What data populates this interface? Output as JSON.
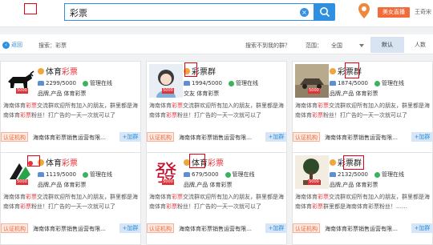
{
  "header": {
    "search_value": "彩票",
    "live_label": "美女直播",
    "user_label": "王奇宋"
  },
  "filters": {
    "back_label": "返回",
    "search_label": "搜索：彩票",
    "not_found": "搜索不到我的群？",
    "range_label": "范围：",
    "range_value": "全国",
    "sort_default": "默认",
    "sort_members": "人数"
  },
  "cards": [
    {
      "title_prefix": "体育",
      "title_hl": "彩票",
      "title_suffix": "",
      "members": "2299/5000",
      "manage": "管理在线",
      "tags": "品牌,产品  体育彩票",
      "desc_a": "海南体育",
      "desc_hl_a": "彩票",
      "desc_b": "交流群欢迎所有加入的朋友，群里都是海南体育",
      "desc_hl_b": "彩票",
      "desc_c": "粉丝！打广告的一天一次就可以了",
      "cert": "认证机构",
      "owner": "海南体育彩票销售运营有限…",
      "join": "+加群",
      "level": "5000"
    },
    {
      "title_prefix": "",
      "title_hl": "",
      "title_suffix": "彩票群",
      "members": "1994/5000",
      "manage": "管理在线",
      "tags": "交友  体育彩票",
      "desc_a": "海南体育",
      "desc_hl_a": "彩票",
      "desc_b": "交流群欢迎所有加入的朋友，群里都是海南体育",
      "desc_hl_b": "彩票",
      "desc_c": "粉丝！打广告的一天一次就可以了",
      "cert": "认证机构",
      "owner": "海南体育彩票销售运营有限…",
      "join": "+加群",
      "level": "5000"
    },
    {
      "title_prefix": "",
      "title_hl": "",
      "title_suffix": "彩票群",
      "members": "1874/5000",
      "manage": "管理在线",
      "tags": "品牌,产品  体育彩票",
      "desc_a": "海南体育",
      "desc_hl_a": "彩票",
      "desc_b": "交流群欢迎所有加入的朋友，群里都是海南体育",
      "desc_hl_b": "彩票",
      "desc_c": "粉丝！打广告的一天一次就可以了",
      "cert": "认证机构",
      "owner": "海南体育彩票销售运营有限…",
      "join": "+加群",
      "level": "5000"
    },
    {
      "title_prefix": "体育",
      "title_hl": "彩票",
      "title_suffix": "",
      "members": "1119/5000",
      "manage": "管理在线",
      "tags": "品牌,产品  体育彩票",
      "desc_a": "海南体育",
      "desc_hl_a": "彩票",
      "desc_b": "交流群欢迎所有加入的朋友，群里都是海南体育",
      "desc_hl_b": "彩票",
      "desc_c": "粉丝！打广告的一天一次就可以了",
      "cert": "认证机构",
      "owner": "海南体育彩票销售运营有限…",
      "join": "+加群",
      "level": "5000"
    },
    {
      "title_prefix": "体育",
      "title_hl": "彩票",
      "title_suffix": "",
      "members": "679/5000",
      "manage": "管理在线",
      "tags": "品牌,产品  体育彩票",
      "desc_a": "海南体育",
      "desc_hl_a": "彩票",
      "desc_b": "交流群欢迎所有加入的朋友，群里都是海南体育",
      "desc_hl_b": "彩票",
      "desc_c": "粉丝！打广告的一天一次就可以了",
      "cert": "认证机构",
      "owner": "海南体育彩票销售运营有限…",
      "join": "+加群",
      "level": "5000"
    },
    {
      "title_prefix": "",
      "title_hl": "",
      "title_suffix": "彩票群",
      "members": "2132/5000",
      "manage": "管理在线",
      "tags": "品牌,产品  体育彩票",
      "desc_a": "海南体育",
      "desc_hl_a": "彩票",
      "desc_b": "交流群欢迎所有加入的朋友，群里都是海南体育",
      "desc_hl_b": "彩票",
      "desc_c": "群里都是海南体育彩票粉丝！……",
      "cert": "认证机构",
      "owner": "海南体育彩票销售运营有限…",
      "join": "+加群",
      "level": "5000"
    }
  ],
  "colors": {
    "accent": "#2f8fe0",
    "highlight": "#e0343c",
    "cert": "#f26b3a"
  }
}
